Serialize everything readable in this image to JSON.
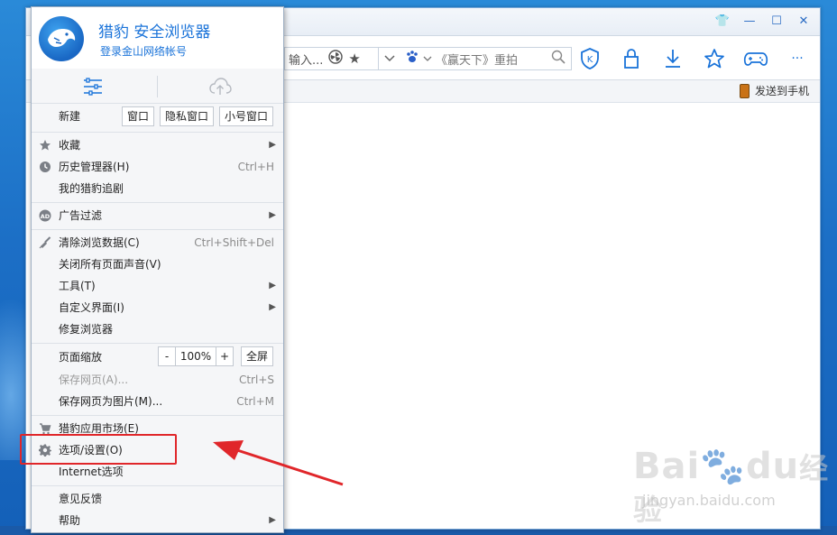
{
  "browser": {
    "window_controls": [
      "👕",
      "—",
      "☐",
      "✕"
    ],
    "address_placeholder": "输入...",
    "search_text": "《赢天下》重拍",
    "send_to_phone": "发送到手机"
  },
  "menu": {
    "brand": "猎豹 安全浏览器",
    "login": "登录金山网络帐号",
    "new_row": {
      "label": "新建",
      "buttons": [
        "窗口",
        "隐私窗口",
        "小号窗口"
      ]
    },
    "group1": [
      {
        "label": "收藏",
        "icon": "star-icon",
        "shortcut": "",
        "submenu": true
      },
      {
        "label": "历史管理器(H)",
        "icon": "clock-icon",
        "shortcut": "Ctrl+H",
        "submenu": false
      },
      {
        "label": "我的猎豹追剧",
        "icon": "",
        "shortcut": "",
        "submenu": false
      }
    ],
    "group2": [
      {
        "label": "广告过滤",
        "icon": "ad-icon",
        "shortcut": "",
        "submenu": true
      }
    ],
    "group3": [
      {
        "label": "清除浏览数据(C)",
        "icon": "broom-icon",
        "shortcut": "Ctrl+Shift+Del",
        "submenu": false
      },
      {
        "label": "关闭所有页面声音(V)",
        "icon": "",
        "shortcut": "",
        "submenu": false
      },
      {
        "label": "工具(T)",
        "icon": "",
        "shortcut": "",
        "submenu": true
      },
      {
        "label": "自定义界面(I)",
        "icon": "",
        "shortcut": "",
        "submenu": true
      },
      {
        "label": "修复浏览器",
        "icon": "",
        "shortcut": "",
        "submenu": false
      }
    ],
    "zoom_row": {
      "label": "页面缩放",
      "minus": "-",
      "value": "100%",
      "plus": "+",
      "full": "全屏"
    },
    "group4": [
      {
        "label": "保存网页(A)...",
        "shortcut": "Ctrl+S",
        "disabled": true
      },
      {
        "label": "保存网页为图片(M)...",
        "shortcut": "Ctrl+M",
        "disabled": false
      }
    ],
    "group5": [
      {
        "label": "猎豹应用市场(E)",
        "icon": "cart-icon"
      },
      {
        "label": "选项/设置(O)",
        "icon": "gear-icon"
      },
      {
        "label": "Internet选项",
        "icon": ""
      }
    ],
    "group6": [
      {
        "label": "意见反馈",
        "submenu": false
      },
      {
        "label": "帮助",
        "submenu": true
      }
    ]
  },
  "watermark": {
    "brand": "Bai",
    "brand2": "du",
    "cn": "经验",
    "url": "jingyan.baidu.com"
  },
  "colors": {
    "accent": "#1a73d9",
    "highlight": "#e0262a"
  }
}
